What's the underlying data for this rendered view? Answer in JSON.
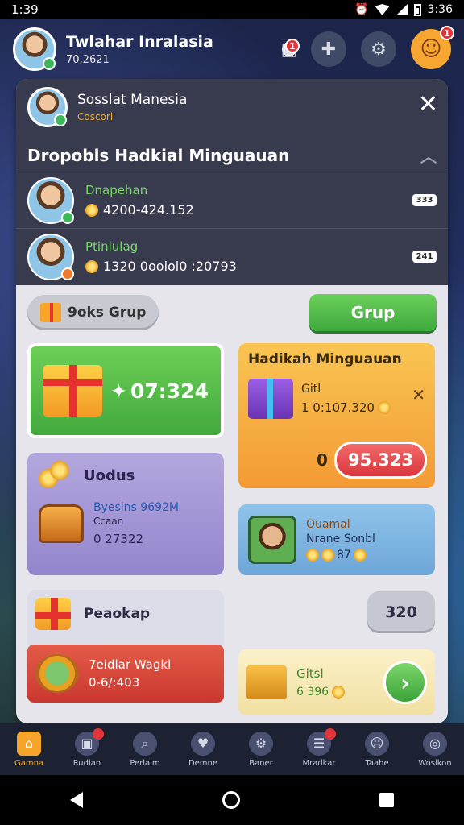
{
  "status_bar": {
    "time": "1:39",
    "clock_right": "3:36"
  },
  "header": {
    "user_name": "Twlahar Inralasia",
    "user_sub": "70,2621",
    "icons": [
      "inbox-icon",
      "add-icon",
      "settings-icon",
      "mascot-icon"
    ],
    "inbox_badge": "1",
    "mascot_badge": "1"
  },
  "panel": {
    "profile_name": "Sosslat Manesia",
    "profile_sub": "Coscori",
    "heading": "Dropobls Hadkial Minguauan",
    "leaderboard": [
      {
        "name": "Dnapehan",
        "score": "4200-424.152",
        "tag": "333"
      },
      {
        "name": "Ptiniulag",
        "score": "1320 0oolol0 :20793",
        "tag": "241"
      }
    ]
  },
  "buttons": {
    "left_pill": "9oks Grup",
    "right_pill": "Grup"
  },
  "cards": {
    "green_timer": "07:324",
    "orange": {
      "title": "Hadikah Minguauan",
      "label": "Gitl",
      "value": "1 0:107.320",
      "q": "0",
      "price": "95.323"
    },
    "purple": {
      "title": "Uodus",
      "l1": "Byesins 9692M",
      "l2": "Ccaan",
      "l3": "0 27322"
    },
    "blue": {
      "l1": "Ouamal",
      "l2": "Nrane Sonbl",
      "l3": "87"
    },
    "light": {
      "title": "Peaokap"
    },
    "gray_pill": "320",
    "red": {
      "l1": "7eidlar Wagkl",
      "l2": "0-6/:403"
    },
    "cream": {
      "l1": "Gitsl",
      "l2": "6 396"
    }
  },
  "bottom_nav": [
    {
      "label": "Gamna",
      "icon": "home-icon"
    },
    {
      "label": "Rudian",
      "icon": "shop-icon"
    },
    {
      "label": "Perlaim",
      "icon": "search-icon"
    },
    {
      "label": "Demne",
      "icon": "heart-icon"
    },
    {
      "label": "Baner",
      "icon": "gear-icon"
    },
    {
      "label": "Mradkar",
      "icon": "news-icon"
    },
    {
      "label": "Taahe",
      "icon": "emoji-icon"
    },
    {
      "label": "Wosikon",
      "icon": "chat-icon"
    }
  ],
  "colors": {
    "accent": "#f6a52a",
    "green": "#42a93c",
    "panel_dark": "#383b4d"
  }
}
